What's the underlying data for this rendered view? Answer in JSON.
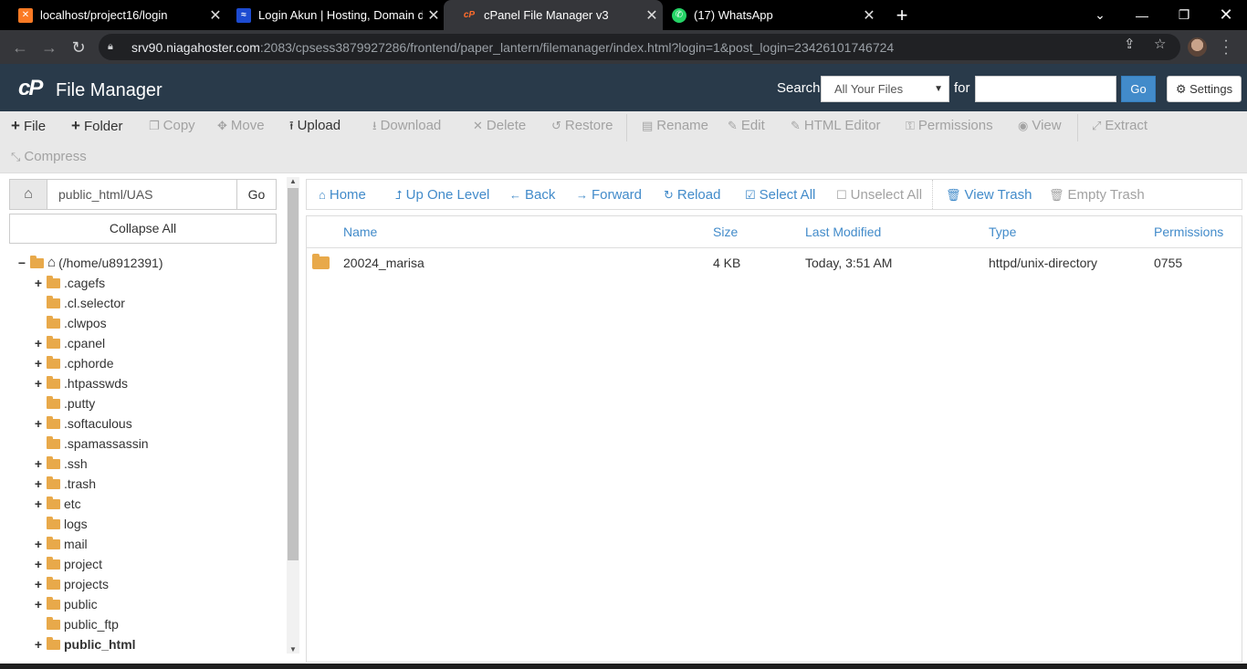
{
  "browser": {
    "tabs": [
      {
        "title": "localhost/project16/login",
        "favicon": "xampp-icon",
        "active": false
      },
      {
        "title": "Login Akun | Hosting, Domain dan",
        "favicon": "niagahoster-icon",
        "active": false
      },
      {
        "title": "cPanel File Manager v3",
        "favicon": "cpanel-icon",
        "active": true
      },
      {
        "title": "(17) WhatsApp",
        "favicon": "whatsapp-icon",
        "active": false
      }
    ],
    "url_host": "srv90.niagahoster.com",
    "url_rest": ":2083/cpsess3879927286/frontend/paper_lantern/filemanager/index.html?login=1&post_login=23426101746724"
  },
  "header": {
    "logo": "cP",
    "title": "File Manager",
    "search_label": "Search",
    "search_scope": "All Your Files",
    "for_label": "for",
    "search_value": "",
    "go_label": "Go",
    "settings_label": "Settings"
  },
  "toolbar": {
    "file": "File",
    "folder": "Folder",
    "copy": "Copy",
    "move": "Move",
    "upload": "Upload",
    "download": "Download",
    "delete": "Delete",
    "restore": "Restore",
    "rename": "Rename",
    "edit": "Edit",
    "html_editor": "HTML Editor",
    "permissions": "Permissions",
    "view": "View",
    "extract": "Extract",
    "compress": "Compress"
  },
  "left": {
    "path": "public_html/UAS",
    "go": "Go",
    "collapse": "Collapse All",
    "root": "(/home/u8912391)",
    "tree": [
      {
        "name": ".cagefs",
        "expandable": true
      },
      {
        "name": ".cl.selector",
        "expandable": false
      },
      {
        "name": ".clwpos",
        "expandable": false
      },
      {
        "name": ".cpanel",
        "expandable": true
      },
      {
        "name": ".cphorde",
        "expandable": true
      },
      {
        "name": ".htpasswds",
        "expandable": true
      },
      {
        "name": ".putty",
        "expandable": false
      },
      {
        "name": ".softaculous",
        "expandable": true
      },
      {
        "name": ".spamassassin",
        "expandable": false
      },
      {
        "name": ".ssh",
        "expandable": true
      },
      {
        "name": ".trash",
        "expandable": true
      },
      {
        "name": "etc",
        "expandable": true
      },
      {
        "name": "logs",
        "expandable": false
      },
      {
        "name": "mail",
        "expandable": true
      },
      {
        "name": "project",
        "expandable": true
      },
      {
        "name": "projects",
        "expandable": true
      },
      {
        "name": "public",
        "expandable": true
      },
      {
        "name": "public_ftp",
        "expandable": false
      },
      {
        "name": "public_html",
        "expandable": true,
        "bold": true
      }
    ]
  },
  "nav": {
    "home": "Home",
    "up": "Up One Level",
    "back": "Back",
    "forward": "Forward",
    "reload": "Reload",
    "select_all": "Select All",
    "unselect_all": "Unselect All",
    "view_trash": "View Trash",
    "empty_trash": "Empty Trash"
  },
  "table": {
    "columns": {
      "name": "Name",
      "size": "Size",
      "modified": "Last Modified",
      "type": "Type",
      "perms": "Permissions"
    },
    "rows": [
      {
        "name": "20024_marisa",
        "size": "4 KB",
        "modified": "Today, 3:51 AM",
        "type": "httpd/unix-directory",
        "perms": "0755"
      }
    ]
  }
}
